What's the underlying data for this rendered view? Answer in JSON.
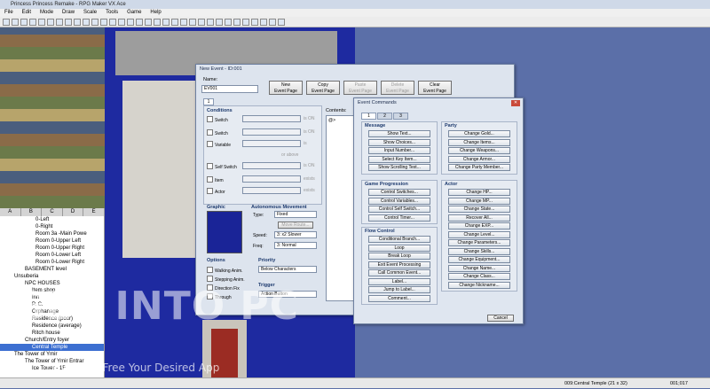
{
  "window": {
    "title": "Princess Princess Remake - RPG Maker VX Ace"
  },
  "menu": [
    "File",
    "Edit",
    "Mode",
    "Draw",
    "Scale",
    "Tools",
    "Game",
    "Help"
  ],
  "tileset_tabs": [
    "A",
    "B",
    "C",
    "D",
    "E"
  ],
  "map_tree": [
    {
      "label": "0-Left",
      "sel": false,
      "indent": 40
    },
    {
      "label": "0-Right",
      "sel": false,
      "indent": 40
    },
    {
      "label": "Room 3a -Main Powe",
      "sel": false,
      "indent": 40
    },
    {
      "label": "Room 0-Upper Left",
      "sel": false,
      "indent": 40
    },
    {
      "label": "Room 0-Upper Right",
      "sel": false,
      "indent": 40
    },
    {
      "label": "Room 0-Lower Left",
      "sel": false,
      "indent": 40
    },
    {
      "label": "Room 0-Lower Right",
      "sel": false,
      "indent": 40
    },
    {
      "label": "BASEMENT level",
      "sel": false,
      "indent": 28
    },
    {
      "label": "Unsuberia",
      "sel": false,
      "indent": 16
    },
    {
      "label": "NPC HOUSES",
      "sel": false,
      "indent": 28
    },
    {
      "label": "Item shop",
      "sel": false,
      "indent": 36
    },
    {
      "label": "Inn",
      "sel": false,
      "indent": 36
    },
    {
      "label": "P. C.",
      "sel": false,
      "indent": 36
    },
    {
      "label": "Orphanage",
      "sel": false,
      "indent": 36
    },
    {
      "label": "Residence (poor)",
      "sel": false,
      "indent": 36
    },
    {
      "label": "Residence (average)",
      "sel": false,
      "indent": 36
    },
    {
      "label": "Ritch house",
      "sel": false,
      "indent": 36
    },
    {
      "label": "Church/Entry foyer",
      "sel": false,
      "indent": 28
    },
    {
      "label": "Central Temple",
      "sel": true,
      "indent": 36
    },
    {
      "label": "The Tower of Ymir",
      "sel": false,
      "indent": 16
    },
    {
      "label": "The Tower of Ymir Entrar",
      "sel": false,
      "indent": 28
    },
    {
      "label": "Ice Tower - 1F",
      "sel": false,
      "indent": 36
    }
  ],
  "status": {
    "map": "009:Central Temple (21 x 32)",
    "coord": "001;017"
  },
  "new_event": {
    "title": "New Event - ID:001",
    "name_label": "Name:",
    "name_value": "EV001",
    "page_buttons": [
      "New\nEvent Page",
      "Copy\nEvent Page",
      "Paste\nEvent Page",
      "Delete\nEvent Page",
      "Clear\nEvent Page"
    ],
    "page_tab": "1",
    "conditions_label": "Conditions",
    "conditions": [
      "Switch",
      "Switch",
      "Variable",
      "Self Switch",
      "Item",
      "Actor"
    ],
    "cond_suffixes": [
      "is ON",
      "is ON",
      "is",
      "is ON",
      "exists",
      "exists"
    ],
    "above_label": "or above",
    "contents_label": "Contents:",
    "contents_item": "@>",
    "graphic_label": "Graphic",
    "autonomous_label": "Autonomous Movement",
    "type_label": "Type:",
    "type_value": "Fixed",
    "move_route_btn": "Move Route...",
    "speed_label": "Speed:",
    "speed_value": "3: x2 Slower",
    "freq_label": "Freq:",
    "freq_value": "3: Normal",
    "options_label": "Options",
    "options": [
      "Walking Anim.",
      "Stepping Anim.",
      "Direction Fix",
      "Through"
    ],
    "priority_label": "Priority",
    "priority_value": "Below Characters",
    "trigger_label": "Trigger",
    "trigger_value": "Action Button"
  },
  "event_commands": {
    "title": "Event Commands",
    "tabs": [
      "1",
      "2",
      "3"
    ],
    "groups": [
      {
        "label": "Message",
        "items": [
          "Show Text...",
          "Show Choices...",
          "Input Number...",
          "Select Key Item...",
          "Show Scrolling Text..."
        ]
      },
      {
        "label": "Game Progression",
        "items": [
          "Control Switches...",
          "Control Variables...",
          "Control Self Switch...",
          "Control Timer..."
        ]
      },
      {
        "label": "Flow Control",
        "items": [
          "Conditional Branch...",
          "Loop",
          "Break Loop",
          "Exit Event Processing",
          "Call Common Event...",
          "Label...",
          "Jump to Label...",
          "Comment..."
        ]
      },
      {
        "label": "Party",
        "items": [
          "Change Gold...",
          "Change Items...",
          "Change Weapons...",
          "Change Armor...",
          "Change Party Member..."
        ]
      },
      {
        "label": "Actor",
        "items": [
          "Change HP...",
          "Change MP...",
          "Change State...",
          "Recover All...",
          "Change EXP...",
          "Change Level...",
          "Change Parameters...",
          "Change Skills...",
          "Change Equipment...",
          "Change Name...",
          "Change Class...",
          "Change Nickname..."
        ]
      }
    ],
    "cancel": "Cancel"
  },
  "watermark": {
    "main": "GET INTO PC",
    "sub": "Download Free Your Desired App"
  }
}
